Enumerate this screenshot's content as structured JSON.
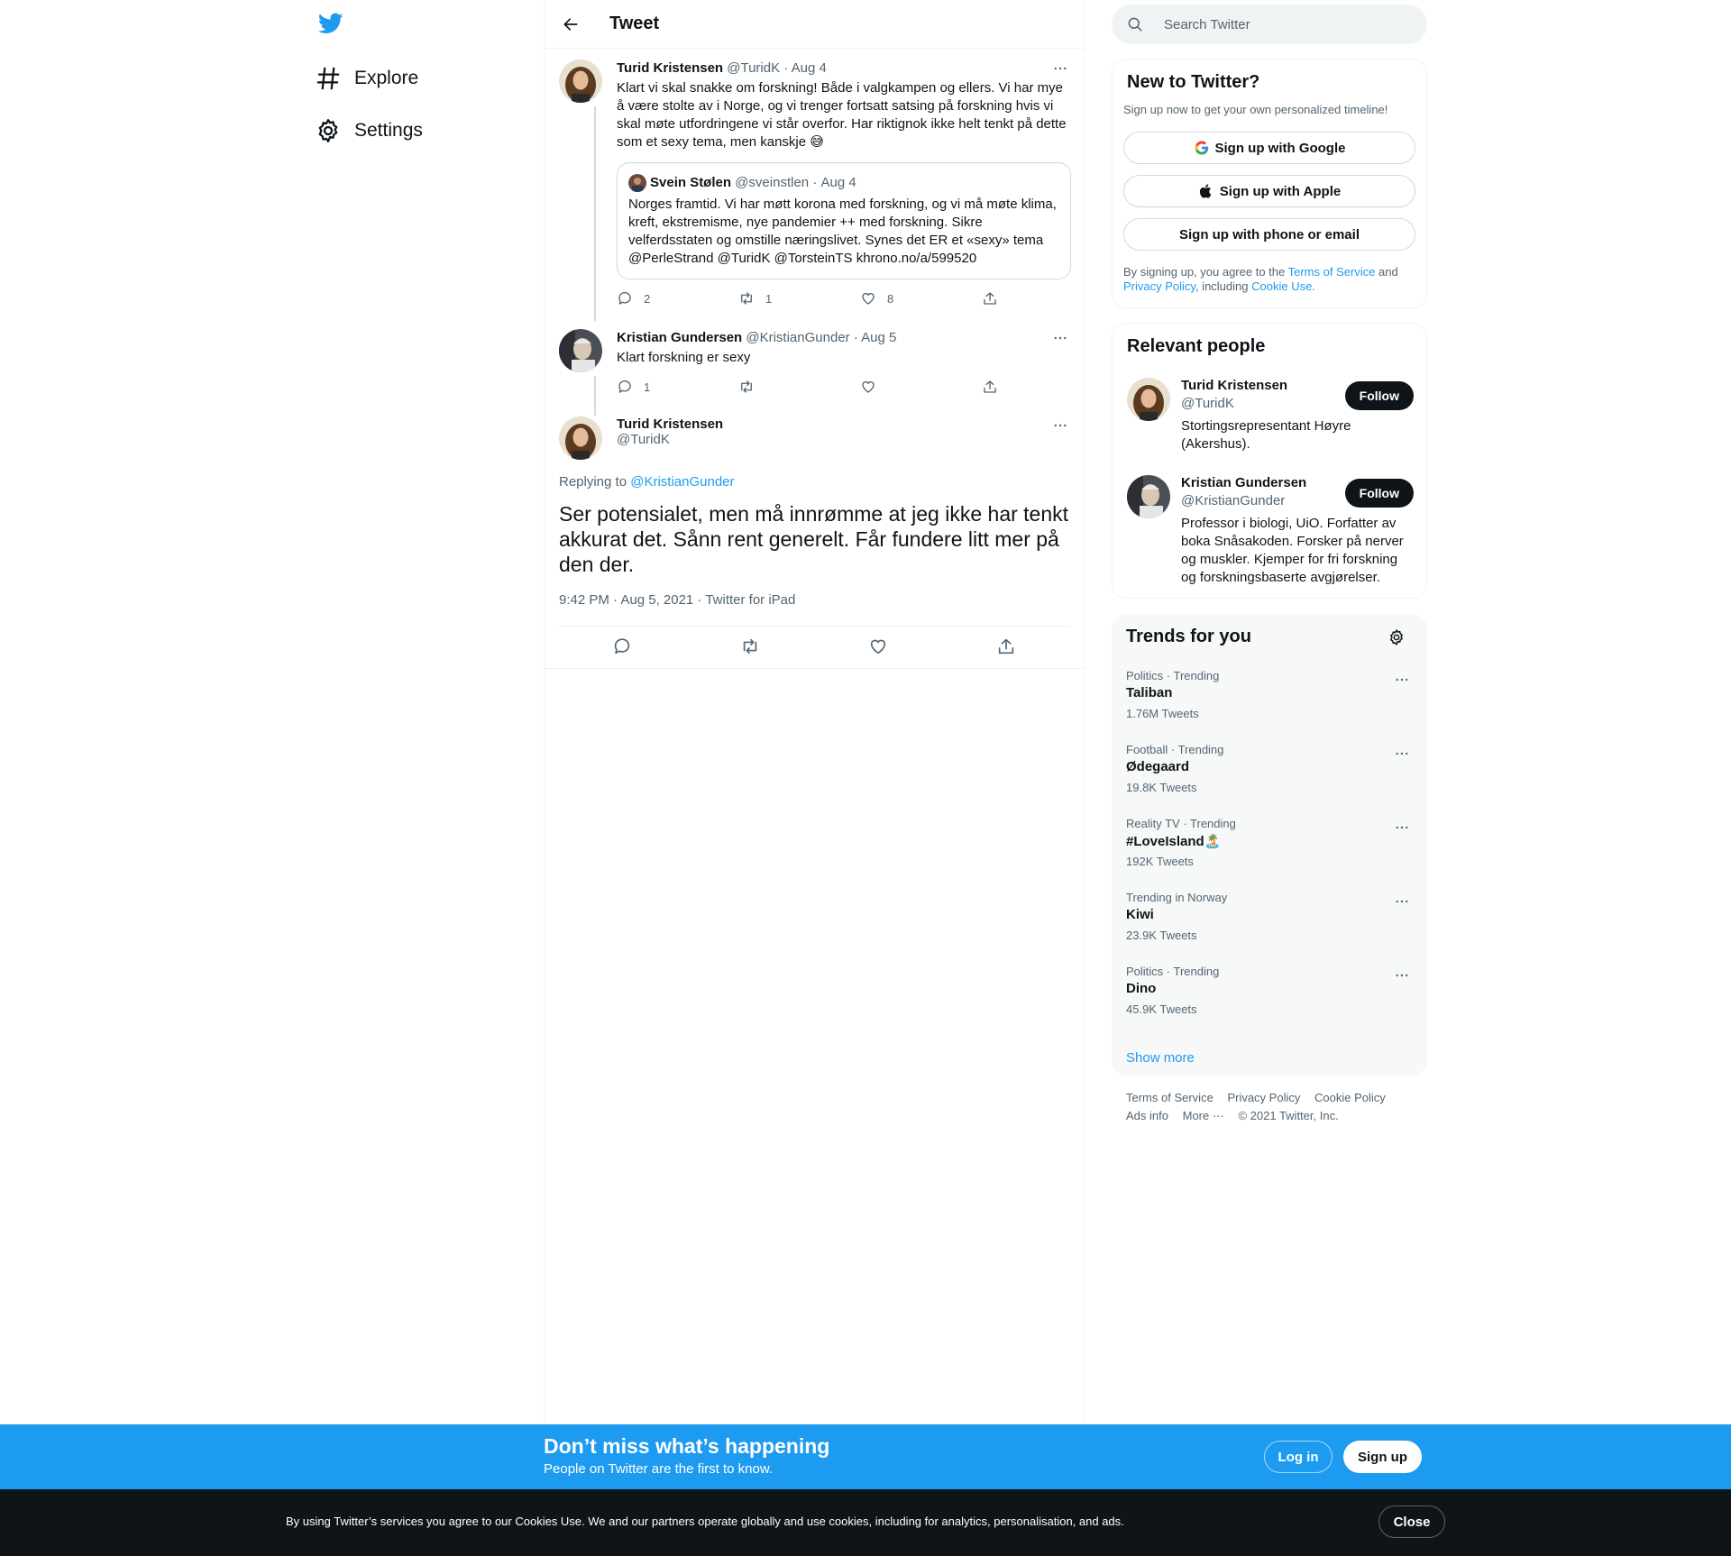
{
  "nav": {
    "logo": "twitter-bird-icon",
    "items": [
      {
        "label": "Explore",
        "icon": "hashtag-icon"
      },
      {
        "label": "Settings",
        "icon": "gear-icon"
      }
    ]
  },
  "header": {
    "title": "Tweet"
  },
  "thread": [
    {
      "name": "Turid Kristensen",
      "handle": "@TuridK",
      "sep": "·",
      "date": "Aug 4",
      "text": "Klart vi skal snakke om forskning! Både i valgkampen og ellers. Vi har mye å være stolte av i Norge, og vi trenger fortsatt satsing på forskning hvis vi skal møte utfordringene vi står overfor. Har riktignok ikke helt tenkt på dette som et sexy tema, men kanskje 😅",
      "quote": {
        "name": "Svein Stølen",
        "handle": "@sveinstlen",
        "sep": "·",
        "date": "Aug 4",
        "text": "Norges framtid. Vi har møtt korona med forskning, og vi må møte klima, kreft, ekstremisme, nye pandemier ++ med forskning. Sikre velferdsstaten og omstille næringslivet. Synes det ER et «sexy» tema @PerleStrand @TuridK @TorsteinTS  khrono.no/a/599520"
      },
      "replies": "2",
      "retweets": "1",
      "likes": "8"
    },
    {
      "name": "Kristian Gundersen",
      "handle": "@KristianGunder",
      "sep": "·",
      "date": "Aug 5",
      "text": "Klart forskning er sexy",
      "replies": "1",
      "retweets": "",
      "likes": ""
    }
  ],
  "focal": {
    "name": "Turid Kristensen",
    "handle": "@TuridK",
    "replying_prefix": "Replying to ",
    "replying_to": "@KristianGunder",
    "text": "Ser potensialet, men må innrømme at jeg ikke har tenkt akkurat det. Sånn rent generelt. Får fundere litt mer på den der.",
    "meta": "9:42 PM · Aug 5, 2021 · Twitter for iPad"
  },
  "search": {
    "placeholder": "Search Twitter"
  },
  "signup_card": {
    "title": "New to Twitter?",
    "subtitle": "Sign up now to get your own personalized timeline!",
    "google": "Sign up with Google",
    "apple": "Sign up with Apple",
    "phone": "Sign up with phone or email",
    "legal_1": "By signing up, you agree to the ",
    "terms": "Terms of Service",
    "legal_2": " and ",
    "privacy": "Privacy Policy",
    "legal_3": ", including ",
    "cookie": "Cookie Use."
  },
  "relevant": {
    "title": "Relevant people",
    "people": [
      {
        "name": "Turid Kristensen",
        "handle": "@TuridK",
        "bio": "Stortingsrepresentant Høyre (Akershus).",
        "follow": "Follow"
      },
      {
        "name": "Kristian Gundersen",
        "handle": "@KristianGunder",
        "bio": "Professor i biologi, UiO. Forfatter av boka Snåsakoden. Forsker på nerver og muskler. Kjemper for fri forskning og forskningsbaserte avgjørelser.",
        "follow": "Follow"
      }
    ]
  },
  "trends": {
    "title": "Trends for you",
    "items": [
      {
        "category": "Politics · Trending",
        "name": "Taliban",
        "count": "1.76M Tweets"
      },
      {
        "category": "Football · Trending",
        "name": "Ødegaard",
        "count": "19.8K Tweets"
      },
      {
        "category": "Reality TV · Trending",
        "name": "#LoveIsland🏝️",
        "count": "192K Tweets"
      },
      {
        "category": "Trending in Norway",
        "name": "Kiwi",
        "count": "23.9K Tweets"
      },
      {
        "category": "Politics · Trending",
        "name": "Dino",
        "count": "45.9K Tweets"
      }
    ],
    "show_more": "Show more"
  },
  "footer": {
    "links": [
      "Terms of Service",
      "Privacy Policy",
      "Cookie Policy",
      "Ads info",
      "More ···",
      "© 2021 Twitter, Inc."
    ]
  },
  "signup_bar": {
    "title": "Don’t miss what’s happening",
    "subtitle": "People on Twitter are the first to know.",
    "login": "Log in",
    "signup": "Sign up"
  },
  "cookie_bar": {
    "text": "By using Twitter’s services you agree to our Cookies Use. We and our partners operate globally and use cookies, including for analytics, personalisation, and ads.",
    "close": "Close"
  },
  "colors": {
    "accent": "#1d9bf0",
    "text": "#0f1419",
    "secondary": "#536471",
    "border": "#eff3f4"
  }
}
